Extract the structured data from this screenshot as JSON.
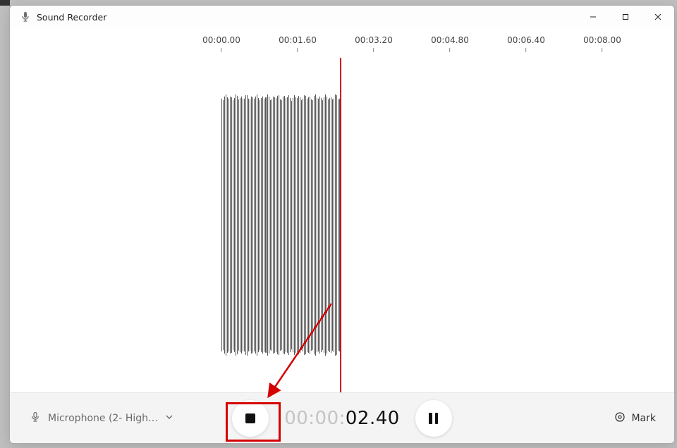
{
  "window": {
    "title": "Sound Recorder"
  },
  "ruler": {
    "ticks": [
      "00:00.00",
      "00:01.60",
      "00:03.20",
      "00:04.80",
      "00:06.40",
      "00:08.00"
    ]
  },
  "waveform": {
    "bar_count": 84,
    "playhead_seconds": 2.4
  },
  "timer": {
    "dim": "00:00:",
    "bright": "02.40"
  },
  "controls": {
    "mic_label": "Microphone (2- High…",
    "mark_label": "Mark"
  },
  "annotation": {
    "target": "stop-button"
  }
}
